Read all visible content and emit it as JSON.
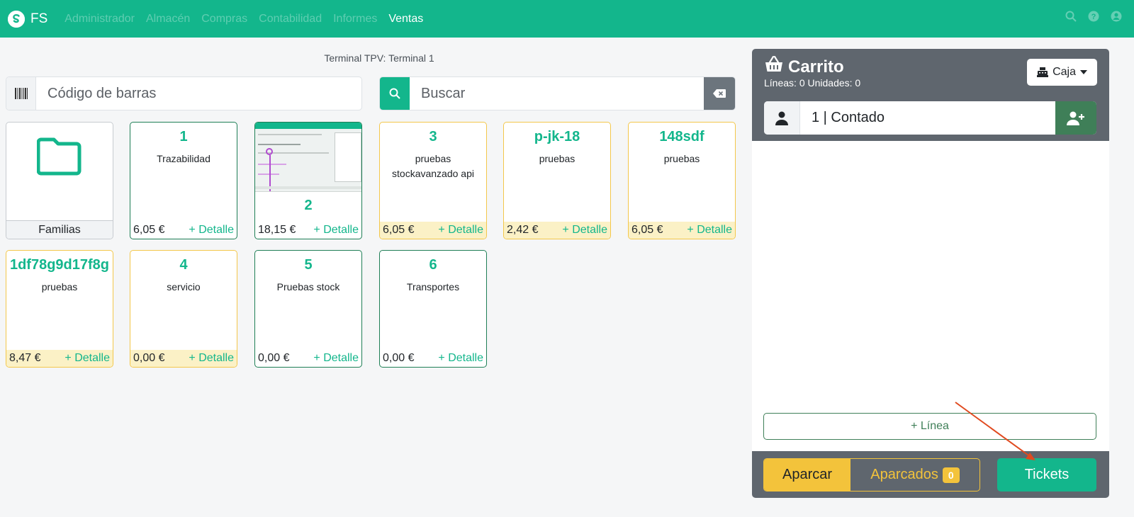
{
  "navbar": {
    "brand": "FS",
    "menu": [
      {
        "label": "Administrador",
        "active": false
      },
      {
        "label": "Almacén",
        "active": false
      },
      {
        "label": "Compras",
        "active": false
      },
      {
        "label": "Contabilidad",
        "active": false
      },
      {
        "label": "Informes",
        "active": false
      },
      {
        "label": "Ventas",
        "active": true
      }
    ],
    "icons": [
      "search-icon",
      "help-icon",
      "user-icon"
    ]
  },
  "terminal": {
    "label": "Terminal TPV: Terminal 1"
  },
  "barcode": {
    "placeholder": "Código de barras"
  },
  "search": {
    "placeholder": "Buscar"
  },
  "families": {
    "label": "Familias"
  },
  "products": [
    {
      "code": "1",
      "description": "Trazabilidad",
      "price": "6,05 €",
      "detail": "+ Detalle",
      "stock_color": "green"
    },
    {
      "code": "2",
      "description": "",
      "price": "18,15 €",
      "detail": "+ Detalle",
      "stock_color": "green",
      "has_image": true
    },
    {
      "code": "3",
      "description": "pruebas stockavanzado api",
      "price": "6,05 €",
      "detail": "+ Detalle",
      "stock_color": "yellow"
    },
    {
      "code": "p-jk-18",
      "description": "pruebas",
      "price": "2,42 €",
      "detail": "+ Detalle",
      "stock_color": "yellow"
    },
    {
      "code": "148sdf",
      "description": "pruebas",
      "price": "6,05 €",
      "detail": "+ Detalle",
      "stock_color": "yellow"
    },
    {
      "code": "1df78g9d17f8g",
      "description": "pruebas",
      "price": "8,47 €",
      "detail": "+ Detalle",
      "stock_color": "yellow"
    },
    {
      "code": "4",
      "description": "servicio",
      "price": "0,00 €",
      "detail": "+ Detalle",
      "stock_color": "yellow"
    },
    {
      "code": "5",
      "description": "Pruebas stock",
      "price": "0,00 €",
      "detail": "+ Detalle",
      "stock_color": "green"
    },
    {
      "code": "6",
      "description": "Transportes",
      "price": "0,00 €",
      "detail": "+ Detalle",
      "stock_color": "green"
    }
  ],
  "cart": {
    "title": "Carrito",
    "summary": "Líneas: 0 Unidades: 0",
    "caja_label": "Caja",
    "customer": "1 | Contado",
    "add_line": "+ Línea",
    "aparcar": "Aparcar",
    "aparcados": "Aparcados",
    "aparcados_count": "0",
    "tickets": "Tickets"
  },
  "colors": {
    "primary": "#13b68c",
    "success_dark": "#3f7f58",
    "warning": "#f3c33b",
    "panel": "#5f666e",
    "annotation_arrow": "#e04a1f"
  }
}
